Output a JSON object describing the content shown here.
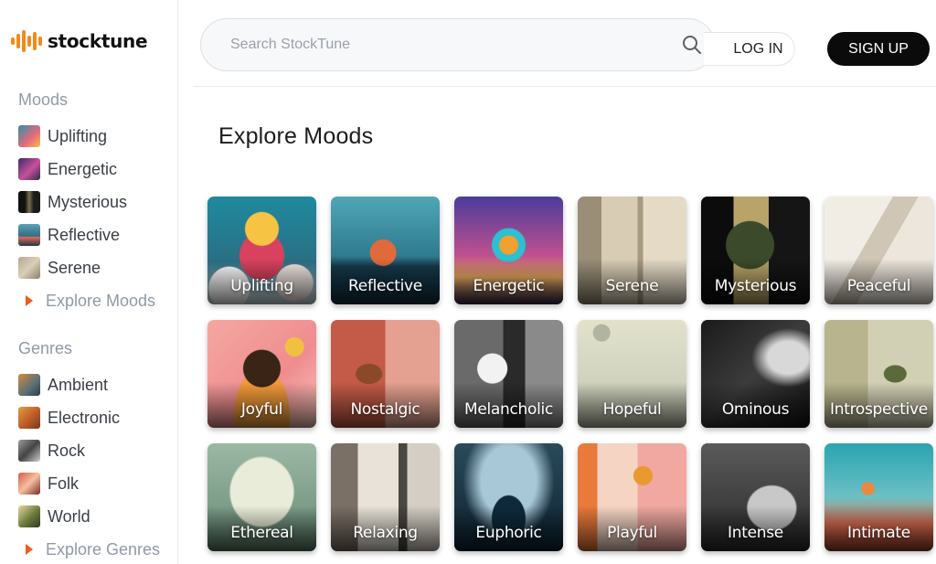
{
  "brand": {
    "name": "stocktune",
    "accent": "#f08a1c"
  },
  "search": {
    "placeholder": "Search StockTune",
    "value": "",
    "icon": "search-icon"
  },
  "auth": {
    "login_label": "LOG IN",
    "signup_label": "SIGN UP"
  },
  "sidebar": {
    "moods": {
      "title": "Moods",
      "items": [
        {
          "label": "Uplifting",
          "thumb": "linear-gradient(135deg,#2f8fa8,#e86a7a 60%,#f3c04a)"
        },
        {
          "label": "Energetic",
          "thumb": "linear-gradient(135deg,#3a2b6b,#c8509a 55%,#2c2c4a)"
        },
        {
          "label": "Mysterious",
          "thumb": "linear-gradient(90deg,#111 30%,#7a7050 50%,#1b1b1b 70%)"
        },
        {
          "label": "Reflective",
          "thumb": "linear-gradient(180deg,#5fa3b5,#2d6e85 55%,#e06a5a 60%,#1e3a44)"
        },
        {
          "label": "Serene",
          "thumb": "linear-gradient(135deg,#b4a88e,#d9cfba 50%,#8c7f66)"
        }
      ],
      "explore_label": "Explore Moods"
    },
    "genres": {
      "title": "Genres",
      "items": [
        {
          "label": "Ambient",
          "thumb": "linear-gradient(135deg,#d48a3c,#5a6f7a 60%,#2e3c44)"
        },
        {
          "label": "Electronic",
          "thumb": "linear-gradient(135deg,#e0a040,#c0602a 50%,#7a3a1a)"
        },
        {
          "label": "Rock",
          "thumb": "linear-gradient(135deg,#9a9a9a,#444 50%,#cfcfcf)"
        },
        {
          "label": "Folk",
          "thumb": "linear-gradient(135deg,#d85a4a,#f4c0a0 50%,#7a2a20)"
        },
        {
          "label": "World",
          "thumb": "linear-gradient(135deg,#e8d8a0,#6a7a3a 55%,#2e3a1a)"
        }
      ],
      "explore_label": "Explore Genres"
    }
  },
  "main": {
    "title": "Explore Moods",
    "moods": [
      {
        "label": "Uplifting",
        "art": "radial-gradient(circle at 50% 30%, #f6c342 0 18px, transparent 19px), radial-gradient(ellipse at 50% 55%, #d8425e 0 24px, transparent 25px), radial-gradient(ellipse at 20% 85%, #ffffff 0 22px, transparent 23px), radial-gradient(ellipse at 80% 80%, #f1e7e2 0 20px, transparent 21px), linear-gradient(180deg,#1f8a9e,#2a6f85 60%,#d9e8ea)"
      },
      {
        "label": "Reflective",
        "art": "radial-gradient(circle at 48% 52%, #e06a3a 0 14px, transparent 15px), linear-gradient(180deg,#4fa6b6 0%,#2f7b90 55%,#16384a 65%,#10303e 100%)"
      },
      {
        "label": "Energetic",
        "art": "radial-gradient(circle at 50% 45%, #f2a030 0 10px, #2cc0d0 11px 18px, transparent 19px), linear-gradient(180deg,#4a3c9a 0%,#c0508f 55%,#f0b060 75%,#3a2a4a 100%)"
      },
      {
        "label": "Serene",
        "art": "linear-gradient(90deg,#9a8e78 0 22%,#d8ccb4 22% 55%,#a89a80 55% 60%,#e4dac6 60% 100%)"
      },
      {
        "label": "Mysterious",
        "art": "radial-gradient(ellipse at 45% 45%, #3a4a2a 0 26px, transparent 27px), linear-gradient(90deg,#0c0c0c 0 30%,#b8a468 30% 62%,#151515 62% 100%)"
      },
      {
        "label": "Peaceful",
        "art": "linear-gradient(120deg,#f2ede4 0 40%,#cfc6b6 40% 55%,#ece6dc 55% 100%)"
      },
      {
        "label": "Joyful",
        "art": "radial-gradient(circle at 50% 45%, #3a2416 0 20px, transparent 21px), radial-gradient(ellipse at 50% 90%, #f29a3a 0 30px, transparent 31px), radial-gradient(circle at 80% 25%, #f2c040 0 10px, transparent 11px), linear-gradient(135deg,#f4a8a0,#f08c90 60%,#f6c4b8)"
      },
      {
        "label": "Nostalgic",
        "art": "radial-gradient(ellipse at 35% 50%, #8a4a2a 0 14px, transparent 15px), linear-gradient(90deg,#c45a48 0 50%,#e4a090 50% 100%)"
      },
      {
        "label": "Melancholic",
        "art": "radial-gradient(circle at 35% 45%, #f2f2f2 0 16px, transparent 17px), linear-gradient(90deg,#6a6a6a 0 45%,#2a2a2a 45% 65%,#8a8a8a 65% 100%)"
      },
      {
        "label": "Hopeful",
        "art": "radial-gradient(circle at 22% 12%, #b0b4a0 0 9px, transparent 10px), linear-gradient(180deg,#e2e2cc 0%,#d0d2be 60%,#b8bca8 100%)"
      },
      {
        "label": "Ominous",
        "art": "radial-gradient(ellipse at 80% 35%, #d8d8d8 0 22px, transparent 40px), linear-gradient(135deg,#1a1a1a,#3c3c3c 50%,#111)"
      },
      {
        "label": "Introspective",
        "art": "radial-gradient(ellipse at 65% 50%, #5a6a3a 0 12px, transparent 13px), linear-gradient(90deg,#b8b48e 0 40%,#d2d0b4 40% 100%)"
      },
      {
        "label": "Ethereal",
        "art": "radial-gradient(ellipse at 50% 45%, #e8ecd8 0 34px, transparent 36px), linear-gradient(180deg,#9cb8a4,#7c9c88 60%,#5a7a68)"
      },
      {
        "label": "Relaxing",
        "art": "linear-gradient(90deg,#7a7066 0 25%,#e8e2d8 25% 62%,#4a4640 62% 70%,#d4cec4 70% 100%)"
      },
      {
        "label": "Euphoric",
        "art": "radial-gradient(ellipse at 50% 70%, #0e2a3a 0 18px, transparent 19px), radial-gradient(ellipse at 50% 35%, #a8c8d8 0 30px, transparent 50px), linear-gradient(180deg,#2a4a5a,#0e2230)"
      },
      {
        "label": "Playful",
        "art": "radial-gradient(circle at 60% 30%, #e89a30 0 10px, transparent 11px), linear-gradient(90deg,#e87a3a 0 18%,#f6d4c4 18% 55%,#f0a8a0 55% 100%)"
      },
      {
        "label": "Intense",
        "art": "radial-gradient(ellipse at 65% 60%, #c8c8c8 0 26px, transparent 28px), linear-gradient(180deg,#5a5a5a,#2a2a2a)"
      },
      {
        "label": "Intimate",
        "art": "radial-gradient(ellipse at 40% 42%, #e88a40 0 7px, transparent 8px), linear-gradient(180deg,#2aa4b0 0%,#6cc0c4 50%,#e07050 75%,#a04030 100%)"
      }
    ]
  }
}
